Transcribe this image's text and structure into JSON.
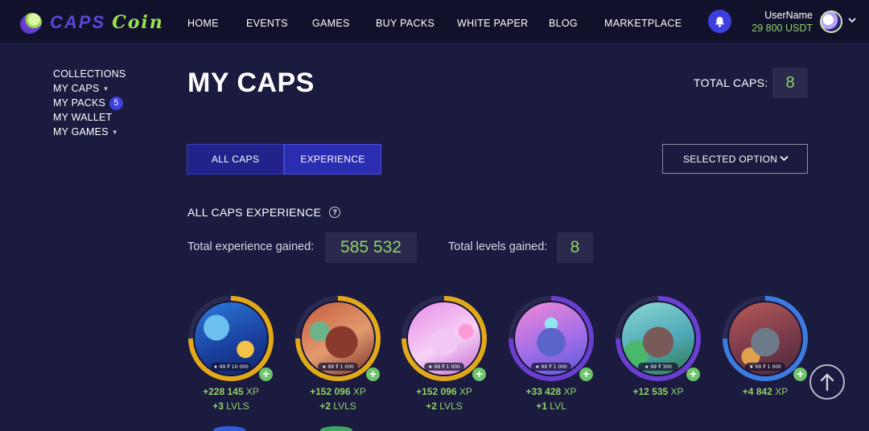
{
  "header": {
    "logo_text_caps": "CAPS",
    "logo_text_coin": "Coin",
    "nav": [
      "HOME",
      "EVENTS",
      "GAMES",
      "BUY PACKS",
      "WHITE PAPER",
      "BLOG",
      "MARKETPLACE"
    ],
    "username": "UserName",
    "balance": "29 800 USDT"
  },
  "sidebar": {
    "items": [
      {
        "label": "COLLECTIONS",
        "caret": false
      },
      {
        "label": "MY CAPS",
        "caret": true
      },
      {
        "label": "MY PACKS",
        "badge": "5"
      },
      {
        "label": "MY WALLET"
      },
      {
        "label": "MY GAMES",
        "caret": true
      }
    ]
  },
  "main": {
    "title": "MY CAPS",
    "total_caps_label": "TOTAL CAPS:",
    "total_caps_value": "8",
    "tabs": [
      {
        "label": "ALL CAPS",
        "active": false
      },
      {
        "label": "EXPERIENCE",
        "active": true
      }
    ],
    "select_label": "SELECTED OPTION",
    "section_title": "ALL CAPS EXPERIENCE",
    "total_xp_label": "Total experience gained:",
    "total_xp_value": "585 532",
    "total_levels_label": "Total levels gained:",
    "total_levels_value": "8"
  },
  "caps": [
    {
      "xp": "+228 145",
      "xp_unit": "XP",
      "lvl_num": "+3",
      "lvl_unit": "LVLS",
      "chip": "★ 99  ₮ 10 000",
      "ring": "#e1a91a"
    },
    {
      "xp": "+152 096",
      "xp_unit": "XP",
      "lvl_num": "+2",
      "lvl_unit": "LVLS",
      "chip": "★ 99  ₮ 1 000",
      "ring": "#e1a91a"
    },
    {
      "xp": "+152 096",
      "xp_unit": "XP",
      "lvl_num": "+2",
      "lvl_unit": "LVLS",
      "chip": "★ 99  ₮ 1 000",
      "ring": "#e1a91a"
    },
    {
      "xp": "+33 428",
      "xp_unit": "XP",
      "lvl_num": "+1",
      "lvl_unit": "LVL",
      "chip": "★ 99  ₮ 1 000",
      "ring": "#6a3fd0"
    },
    {
      "xp": "+12 535",
      "xp_unit": "XP",
      "lvl_num": "",
      "lvl_unit": "",
      "chip": "★ 99  ₮ 300",
      "ring": "#6a3fd0"
    },
    {
      "xp": "+4 842",
      "xp_unit": "XP",
      "lvl_num": "",
      "lvl_unit": "",
      "chip": "★ 99  ₮ 1 000",
      "ring": "#3d7be0"
    }
  ],
  "colors": {
    "background": "#1b1a3f",
    "header": "#12112c",
    "accent_blue": "#3d3fe0",
    "green": "#8fd268"
  }
}
